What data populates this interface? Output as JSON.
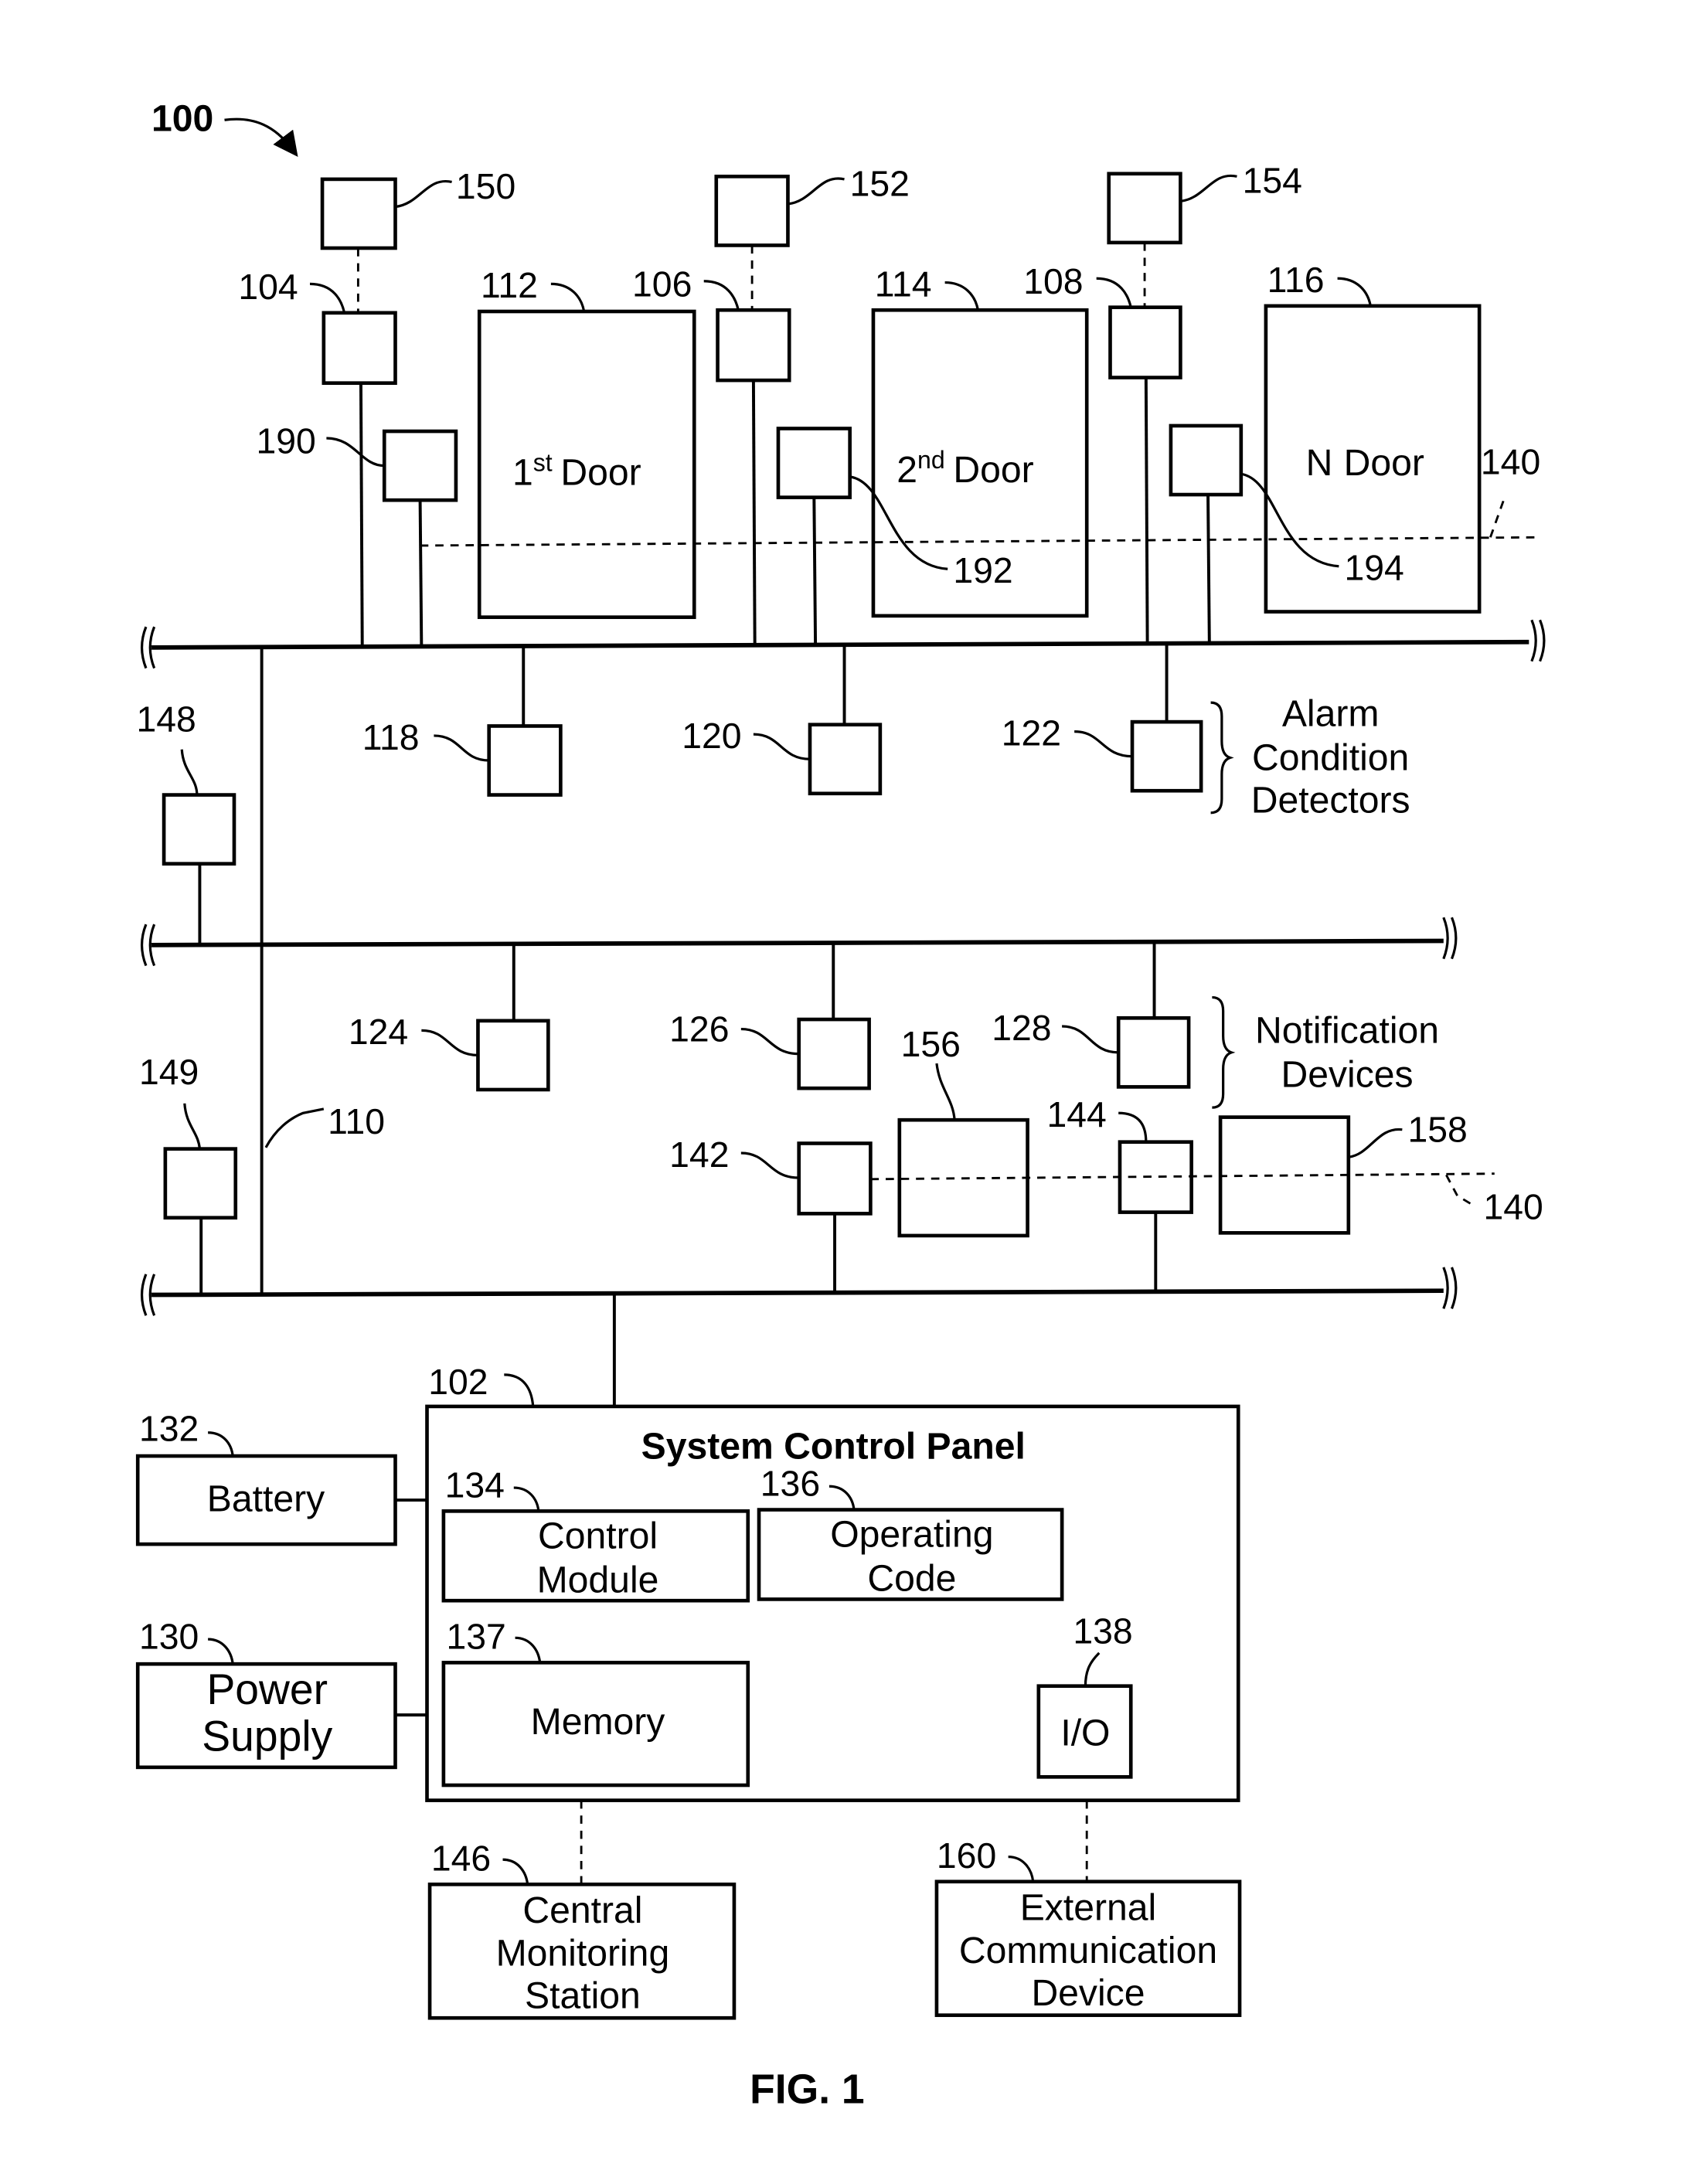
{
  "figure": {
    "system_ref": "100",
    "caption": "FIG. 1"
  },
  "doors": [
    {
      "ref": "112",
      "num": "1",
      "sup": "st",
      "word": "Door"
    },
    {
      "ref": "114",
      "num": "2",
      "sup": "nd",
      "word": "Door"
    },
    {
      "ref": "116",
      "num": "N",
      "sup": "",
      "word": "Door"
    }
  ],
  "door_controllers": [
    {
      "ref": "104"
    },
    {
      "ref": "106"
    },
    {
      "ref": "108"
    }
  ],
  "remote_units": [
    {
      "ref": "150"
    },
    {
      "ref": "152"
    },
    {
      "ref": "154"
    }
  ],
  "door_sensors": [
    {
      "ref": "190"
    },
    {
      "ref": "192"
    },
    {
      "ref": "194"
    }
  ],
  "wireless_link_ref": "140",
  "alarm_condition_detectors": {
    "refs": [
      "118",
      "120",
      "122"
    ],
    "label_lines": [
      "Alarm",
      "Condition",
      "Detectors"
    ]
  },
  "notification_devices": {
    "refs": [
      "124",
      "126",
      "128"
    ],
    "label_lines": [
      "Notification",
      "Devices"
    ]
  },
  "bus_devices": {
    "left_upper": "148",
    "left_lower": "149",
    "trunk": "110"
  },
  "wireless_devices": {
    "r142": "142",
    "r144": "144",
    "r156": "156",
    "r158": "158"
  },
  "panel": {
    "ref": "102",
    "title": "System Control Panel",
    "control_module": {
      "ref": "134",
      "lines": [
        "Control",
        "Module"
      ]
    },
    "operating_code": {
      "ref": "136",
      "lines": [
        "Operating",
        "Code"
      ]
    },
    "memory": {
      "ref": "137",
      "label": "Memory"
    },
    "io": {
      "ref": "138",
      "label": "I/O"
    }
  },
  "battery": {
    "ref": "132",
    "label": "Battery"
  },
  "power_supply": {
    "ref": "130",
    "lines": [
      "Power",
      "Supply"
    ]
  },
  "central_monitoring": {
    "ref": "146",
    "lines": [
      "Central",
      "Monitoring",
      "Station"
    ]
  },
  "external_comm": {
    "ref": "160",
    "lines": [
      "External",
      "Communication",
      "Device"
    ]
  }
}
